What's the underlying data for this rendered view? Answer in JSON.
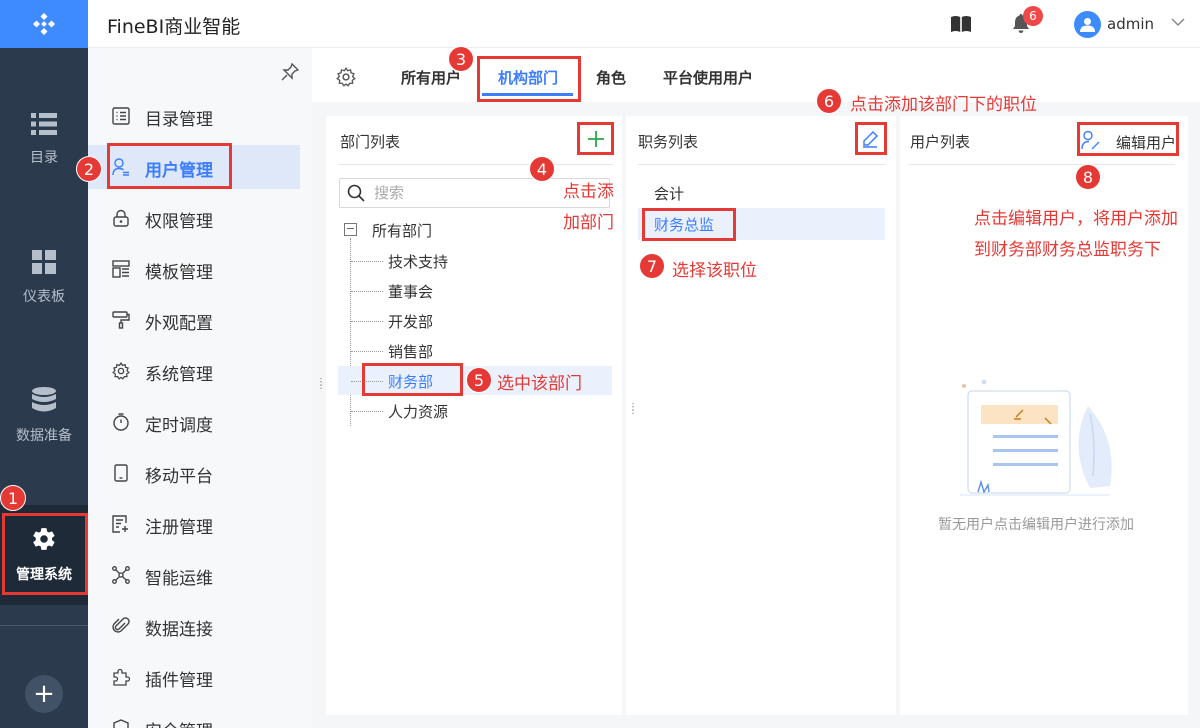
{
  "app": {
    "title": "FineBI商业智能"
  },
  "topbar": {
    "notification_count": "6",
    "user_name": "admin"
  },
  "rail": {
    "items": [
      {
        "label": "目录",
        "icon": "catalog-icon"
      },
      {
        "label": "仪表板",
        "icon": "dashboard-icon"
      },
      {
        "label": "数据准备",
        "icon": "database-icon"
      },
      {
        "label": "管理系统",
        "icon": "gear-icon"
      }
    ],
    "add_label": "+"
  },
  "subnav": {
    "items": [
      {
        "label": "目录管理",
        "icon": "catalog-manage-icon"
      },
      {
        "label": "用户管理",
        "icon": "user-icon"
      },
      {
        "label": "权限管理",
        "icon": "lock-icon"
      },
      {
        "label": "模板管理",
        "icon": "template-icon"
      },
      {
        "label": "外观配置",
        "icon": "paint-roller-icon"
      },
      {
        "label": "系统管理",
        "icon": "gear-icon"
      },
      {
        "label": "定时调度",
        "icon": "timer-icon"
      },
      {
        "label": "移动平台",
        "icon": "mobile-icon"
      },
      {
        "label": "注册管理",
        "icon": "register-icon"
      },
      {
        "label": "智能运维",
        "icon": "network-icon"
      },
      {
        "label": "数据连接",
        "icon": "link-icon"
      },
      {
        "label": "插件管理",
        "icon": "plugin-icon"
      },
      {
        "label": "安全管理",
        "icon": "shield-icon"
      }
    ]
  },
  "tabs": [
    "所有用户",
    "机构部门",
    "角色",
    "平台使用用户"
  ],
  "dept_panel": {
    "title": "部门列表",
    "search_placeholder": "搜索",
    "root": "所有部门",
    "children": [
      "技术支持",
      "董事会",
      "开发部",
      "销售部",
      "财务部",
      "人力资源"
    ]
  },
  "job_panel": {
    "title": "职务列表",
    "items": [
      "会计",
      "财务总监"
    ]
  },
  "user_panel": {
    "title": "用户列表",
    "edit_label": "编辑用户",
    "empty_text": "暂无用户点击编辑用户进行添加"
  },
  "annotations": {
    "step1": "1",
    "step2": "2",
    "step3": "3",
    "step4": "4",
    "step5": "5",
    "step6": "6",
    "step7": "7",
    "step8": "8",
    "note4_line1": "点击添",
    "note4_line2": "加部门",
    "note5": "选中该部门",
    "note6": "点击添加该部门下的职位",
    "note7": "选择该职位",
    "note8_line1": "点击编辑用户，将用户添加",
    "note8_line2": "到财务部财务总监职务下"
  },
  "colors": {
    "accent": "#3d7dff",
    "rail": "#2b3a4d",
    "annotation": "#e53935",
    "add_green": "#2ba84a"
  }
}
